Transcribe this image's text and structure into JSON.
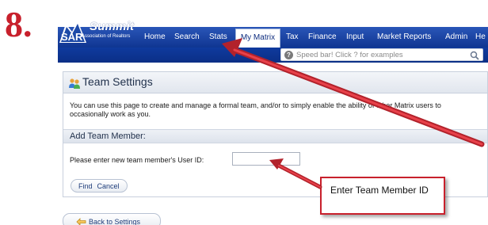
{
  "step_number": "8.",
  "logo": {
    "title": "Summit",
    "subtitle": "Association of Realtors"
  },
  "nav": {
    "items": [
      "Home",
      "Search",
      "Stats",
      "My Matrix",
      "Tax",
      "Finance",
      "Input",
      "Market Reports",
      "Admin",
      "He"
    ],
    "active": "My Matrix"
  },
  "speedbar": {
    "placeholder": "Speed bar! Click ? for examples",
    "help_icon": "?"
  },
  "panel": {
    "title": "Team Settings",
    "description": "You can use this page to create and manage a formal team, and/or to simply enable the ability of other Matrix users to occasionally work as you.",
    "section_title": "Add Team Member:",
    "field_label": "Please enter new team member's User ID:",
    "field_value": "",
    "find_label": "Find",
    "cancel_label": "Cancel"
  },
  "back_button": "Back to Settings",
  "callout": "Enter Team Member ID",
  "colors": {
    "nav_blue": "#1d4aa8",
    "annotation_red": "#c8202c"
  },
  "icons": [
    "team-icon",
    "help-icon",
    "search-icon",
    "back-arrow-icon"
  ]
}
